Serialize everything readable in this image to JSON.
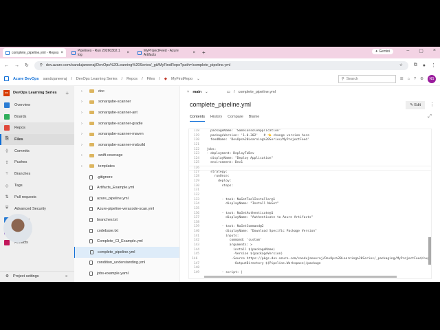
{
  "browser": {
    "tabs": [
      {
        "label": "complete_pipeline.yml - Repos"
      },
      {
        "label": "Pipelines - Run 20260302.1 log"
      },
      {
        "label": "MyProjectFeed - Azure Artifacts"
      }
    ],
    "gemini": "✦ Gemini",
    "url": "dev.azure.com/sandujaneeraj/DevOps%20Learning%20Series/_git/MyFirstRepo?path=/complete_pipeline.yml"
  },
  "header": {
    "brand": "Azure DevOps",
    "org": "sandujaneeraj",
    "project": "DevOps Learning Series",
    "section": "Repos",
    "page": "Files",
    "repo": "MyFirstRepo",
    "search_placeholder": "Search",
    "avatar": "NS"
  },
  "sidebar": {
    "project": "DevOps Learning Series",
    "badge": "DS",
    "items": [
      {
        "label": "Overview",
        "color": "#2b7cd3"
      },
      {
        "label": "Boards",
        "color": "#2fae5b"
      },
      {
        "label": "Repos",
        "color": "#e0483b"
      },
      {
        "label": "Files"
      },
      {
        "label": "Commits"
      },
      {
        "label": "Pushes"
      },
      {
        "label": "Branches"
      },
      {
        "label": "Tags"
      },
      {
        "label": "Pull requests"
      },
      {
        "label": "Advanced Security"
      },
      {
        "label": "Pipelines",
        "color": "#2b7cd3"
      },
      {
        "label": "Test Plans",
        "color": "#7b3fb8"
      },
      {
        "label": "Artifacts",
        "color": "#c2185b"
      }
    ],
    "settings": "Project settings"
  },
  "tree": [
    {
      "name": "doc",
      "type": "folder"
    },
    {
      "name": "sonarqube-scanner",
      "type": "folder"
    },
    {
      "name": "sonarqube-scanner-ant",
      "type": "folder"
    },
    {
      "name": "sonarqube-scanner-gradle",
      "type": "folder"
    },
    {
      "name": "sonarqube-scanner-maven",
      "type": "folder"
    },
    {
      "name": "sonarqube-scanner-msbuild",
      "type": "folder"
    },
    {
      "name": "swift-coverage",
      "type": "folder"
    },
    {
      "name": "templates",
      "type": "folder"
    },
    {
      "name": ".gitignore",
      "type": "file"
    },
    {
      "name": "Artifacts_Example.yml",
      "type": "file"
    },
    {
      "name": "azure_pipeline.yml",
      "type": "file"
    },
    {
      "name": "Azure-pipeline-veracode-scan.yml",
      "type": "file"
    },
    {
      "name": "branches.txt",
      "type": "file"
    },
    {
      "name": "codebase.txt",
      "type": "file"
    },
    {
      "name": "Complete_CI_Example.yml",
      "type": "file"
    },
    {
      "name": "complete_pipeline.yml",
      "type": "file",
      "selected": true
    },
    {
      "name": "condition_understanding.yml",
      "type": "file"
    },
    {
      "name": "jobs-example.yaml",
      "type": "file"
    }
  ],
  "file": {
    "branch": "main",
    "path": "complete_pipeline.yml",
    "title": "complete_pipeline.yml",
    "edit": "Edit",
    "tabs": [
      "Contents",
      "History",
      "Compare",
      "Blame"
    ]
  },
  "code": [
    [
      "118",
      "    packageName: 'SomeConsoleApplication'"
    ],
    [
      "119",
      "    packageVersion: '1.0.302'   # 👈 change version here"
    ],
    [
      "120",
      "    feedName: 'DevOps%20Learning%20Series/MyProjectFeed'"
    ],
    [
      "121",
      ""
    ],
    [
      "122",
      "  jobs:"
    ],
    [
      "123",
      "  - deployment: DeployToDev"
    ],
    [
      "124",
      "    displayName: \"Deploy Application\""
    ],
    [
      "125",
      "    environment: Dev1"
    ],
    [
      "126",
      ""
    ],
    [
      "127",
      "    strategy:"
    ],
    [
      "128",
      "      runOnce:"
    ],
    [
      "129",
      "        deploy:"
    ],
    [
      "130",
      "          steps:"
    ],
    [
      "131",
      ""
    ],
    [
      "132",
      ""
    ],
    [
      "133",
      "          - task: NuGetToolInstaller@1"
    ],
    [
      "134",
      "            displayName: \"Install NuGet\""
    ],
    [
      "135",
      ""
    ],
    [
      "136",
      "          - task: NuGetAuthenticate@1"
    ],
    [
      "137",
      "            displayName: \"Authenticate to Azure Artifacts\""
    ],
    [
      "138",
      ""
    ],
    [
      "139",
      "          - task: NuGetCommand@2"
    ],
    [
      "140",
      "            displayName: \"Download Specific Package Version\""
    ],
    [
      "141",
      "            inputs:"
    ],
    [
      "142",
      "              command: 'custom'"
    ],
    [
      "143",
      "              arguments: >"
    ],
    [
      "144",
      "                install $(packageName)"
    ],
    [
      "145",
      "                -Version $(packageVersion)"
    ],
    [
      "146",
      "                -Source https://pkgs.dev.azure.com/sandujaneeraj/DevOps%20Learning%20Series/_packaging/MyProjectFeed/nuge"
    ],
    [
      "147",
      "                -OutputDirectory $(Pipeline.Workspace)/package"
    ],
    [
      "148",
      ""
    ],
    [
      "149",
      "          - script: |"
    ]
  ]
}
